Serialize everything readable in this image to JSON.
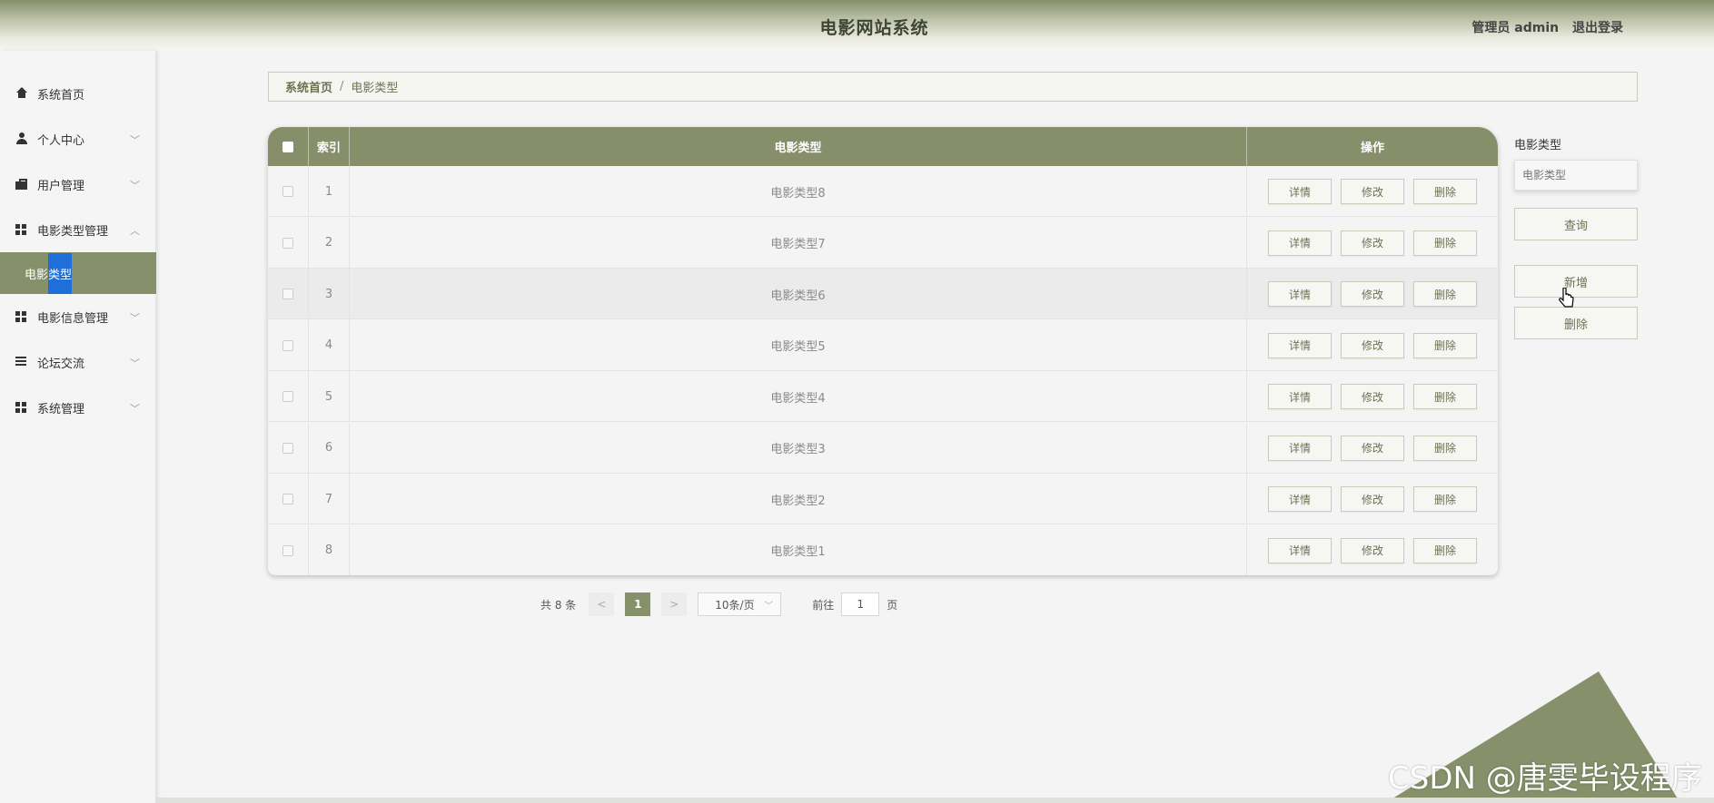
{
  "header": {
    "title": "电影网站系统",
    "user_label": "管理员 admin",
    "logout_label": "退出登录"
  },
  "sidebar": {
    "items": [
      {
        "label": "系统首页",
        "icon": "home-icon"
      },
      {
        "label": "个人中心",
        "icon": "user-icon"
      },
      {
        "label": "用户管理",
        "icon": "briefcase-icon"
      },
      {
        "label": "电影类型管理",
        "icon": "grid-icon"
      },
      {
        "label": "电影信息管理",
        "icon": "grid-icon"
      },
      {
        "label": "论坛交流",
        "icon": "list-icon"
      },
      {
        "label": "系统管理",
        "icon": "grid-icon"
      }
    ],
    "active_sub": {
      "label_a": "电影",
      "label_b": "类型"
    }
  },
  "breadcrumb": {
    "home": "系统首页",
    "separator": "/",
    "current": "电影类型"
  },
  "table": {
    "headers": {
      "index": "索引",
      "type": "电影类型",
      "action": "操作"
    },
    "rows": [
      {
        "index": "1",
        "type": "电影类型8"
      },
      {
        "index": "2",
        "type": "电影类型7"
      },
      {
        "index": "3",
        "type": "电影类型6"
      },
      {
        "index": "4",
        "type": "电影类型5"
      },
      {
        "index": "5",
        "type": "电影类型4"
      },
      {
        "index": "6",
        "type": "电影类型3"
      },
      {
        "index": "7",
        "type": "电影类型2"
      },
      {
        "index": "8",
        "type": "电影类型1"
      }
    ],
    "actions": {
      "detail": "详情",
      "edit": "修改",
      "delete": "删除"
    }
  },
  "pagination": {
    "total_label": "共 8 条",
    "prev": "<",
    "current_page": "1",
    "next": ">",
    "page_size": "10条/页",
    "goto_label": "前往",
    "goto_value": "1",
    "page_unit": "页"
  },
  "search_panel": {
    "label": "电影类型",
    "placeholder": "电影类型",
    "query_button": "查询",
    "add_button": "新增",
    "delete_button": "删除"
  },
  "watermark": "CSDN @唐雯毕设程序",
  "theme": {
    "accent": "#86906a",
    "highlight": "#1e6fd9"
  }
}
